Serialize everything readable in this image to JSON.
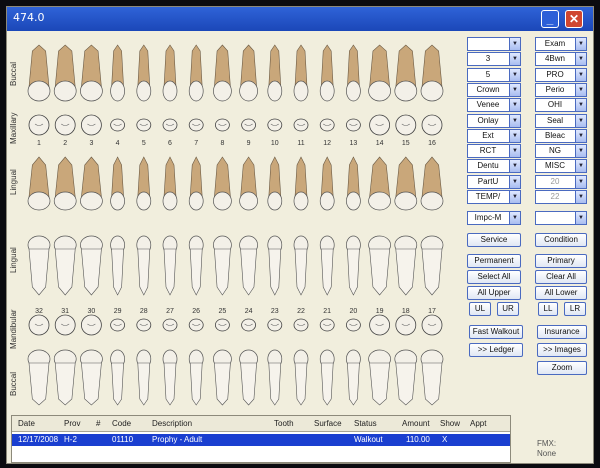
{
  "window": {
    "title": "474.0"
  },
  "side_labels": {
    "buccal_top": "Buccal",
    "maxillary": "Maxillary",
    "lingual_top": "Lingual",
    "lingual_bottom": "Lingual",
    "mandibular": "Mandibular",
    "buccal_bottom": "Buccal"
  },
  "upper_numbers": [
    "1",
    "2",
    "3",
    "4",
    "5",
    "6",
    "7",
    "8",
    "9",
    "10",
    "11",
    "12",
    "13",
    "14",
    "15",
    "16"
  ],
  "lower_numbers": [
    "32",
    "31",
    "30",
    "29",
    "28",
    "27",
    "26",
    "25",
    "24",
    "23",
    "22",
    "21",
    "20",
    "19",
    "18",
    "17"
  ],
  "left_dropdowns": [
    {
      "value": ""
    },
    {
      "value": "3"
    },
    {
      "value": "5"
    },
    {
      "value": "Crown"
    },
    {
      "value": "Venee"
    },
    {
      "value": "Onlay"
    },
    {
      "value": "Ext"
    },
    {
      "value": "RCT"
    },
    {
      "value": "Dentu"
    },
    {
      "value": "PartU"
    },
    {
      "value": "TEMP/"
    }
  ],
  "right_dropdowns": [
    {
      "value": "Exam"
    },
    {
      "value": "4Bwn"
    },
    {
      "value": "PRO"
    },
    {
      "value": "Perio"
    },
    {
      "value": "OHI"
    },
    {
      "value": "Seal"
    },
    {
      "value": "Bleac"
    },
    {
      "value": "NG"
    },
    {
      "value": "MISC"
    },
    {
      "value": "20"
    },
    {
      "value": "22"
    }
  ],
  "impc_dropdown": "Impc-M",
  "blank_dropdown": "",
  "buttons": {
    "service": "Service",
    "condition": "Condition",
    "permanent": "Permanent",
    "primary": "Primary",
    "select_all": "Select All",
    "clear_all": "Clear All",
    "all_upper": "All Upper",
    "all_lower": "All Lower",
    "ul": "UL",
    "ur": "UR",
    "ll": "LL",
    "lr": "LR",
    "fast_walkout": "Fast Walkout",
    "insurance": "Insurance",
    "ledger": ">> Ledger",
    "images": ">> Images",
    "zoom": "Zoom"
  },
  "table": {
    "headers": [
      "Date",
      "Prov",
      "#",
      "Code",
      "Description",
      "Tooth",
      "Surface",
      "Status",
      "Amount",
      "Show",
      "Appt"
    ],
    "rows": [
      [
        "12/17/2008",
        "H-2",
        "",
        "01110",
        "Prophy - Adult",
        "",
        "",
        "Walkout",
        "110.00",
        "X",
        ""
      ]
    ]
  },
  "fmx": {
    "label": "FMX:",
    "value": "None"
  },
  "colors": {
    "window_bg": "#f1eedd",
    "titlebar": "#1b47b8",
    "selection": "#1a3fd0",
    "tooth": "#f3f0e8",
    "root": "#c9a77a"
  }
}
